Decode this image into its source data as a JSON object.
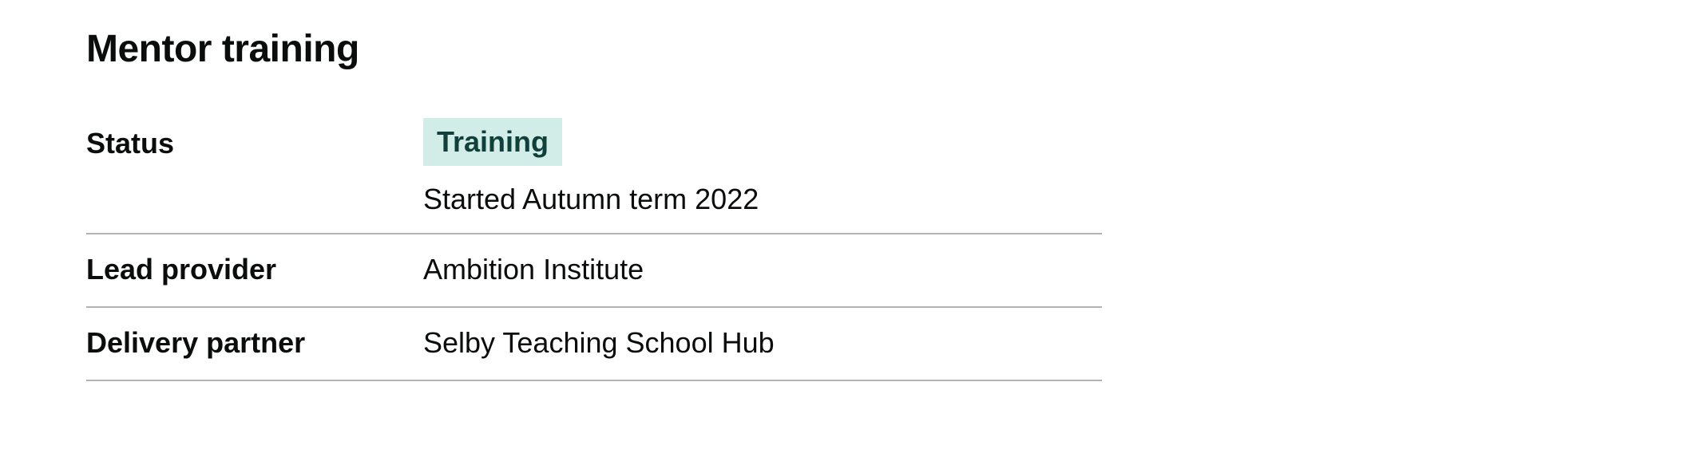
{
  "section": {
    "title": "Mentor training"
  },
  "summary": {
    "status": {
      "key": "Status",
      "tag": "Training",
      "note": "Started Autumn term 2022",
      "tag_colors": {
        "background": "#d2ece8",
        "text": "#10403c"
      }
    },
    "lead_provider": {
      "key": "Lead provider",
      "value": "Ambition Institute"
    },
    "delivery_partner": {
      "key": "Delivery partner",
      "value": "Selby Teaching School Hub"
    }
  },
  "colors": {
    "text": "#0b0c0c",
    "divider": "#b1b4b6",
    "background": "#ffffff"
  }
}
